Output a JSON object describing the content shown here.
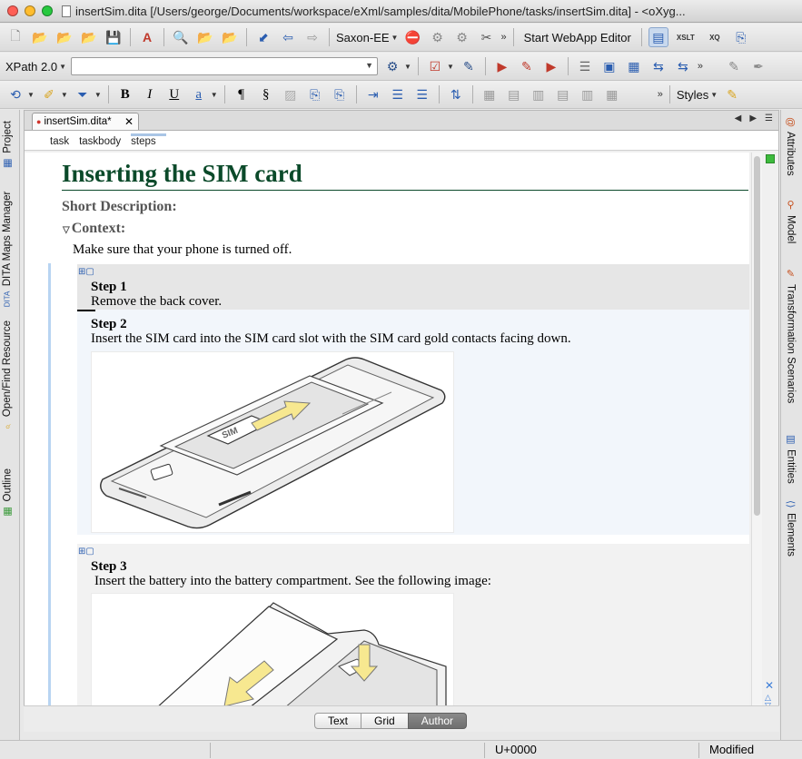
{
  "window": {
    "title": "insertSim.dita [/Users/george/Documents/workspace/eXml/samples/dita/MobilePhone/tasks/insertSim.dita] - <oXyg..."
  },
  "toolbar1": {
    "transformer": "Saxon-EE",
    "webapp_label": "Start WebApp Editor",
    "xslt_label": "XSLT",
    "xq_label": "XQ"
  },
  "toolbar2": {
    "xpath_version": "XPath 2.0",
    "xpath_value": ""
  },
  "toolbar3": {
    "styles_label": "Styles",
    "bold": "B",
    "italic": "I",
    "underline": "U",
    "link": "a",
    "pilcrow": "¶",
    "section": "§"
  },
  "left_tabs": [
    "Project",
    "DITA Maps Manager",
    "Open/Find Resource",
    "Outline"
  ],
  "right_tabs": [
    "Attributes",
    "Model",
    "Transformation Scenarios",
    "Entities",
    "Elements"
  ],
  "editor": {
    "file_tab": "insertSim.dita*",
    "breadcrumb": [
      "task",
      "taskbody",
      "steps"
    ]
  },
  "document": {
    "title": "Inserting the SIM card",
    "short_description_label": "Short Description:",
    "context_label": "Context:",
    "context_text": "Make sure that your phone is turned off.",
    "steps": [
      {
        "heading": "Step 1",
        "text": "Remove the back cover."
      },
      {
        "heading": "Step 2",
        "text": "Insert the SIM card into the SIM card slot with the SIM card gold contacts facing down.",
        "image_label": "SIM"
      },
      {
        "heading": "Step 3",
        "text": "Insert the battery into the battery compartment. See the following image:"
      }
    ]
  },
  "modes": {
    "text": "Text",
    "grid": "Grid",
    "author": "Author",
    "active": "Author"
  },
  "status": {
    "unicode": "U+0000",
    "state": "Modified"
  },
  "colors": {
    "title": "#0b4a2a",
    "arrow_fill": "#f7e890",
    "active_mode": "#777777"
  }
}
